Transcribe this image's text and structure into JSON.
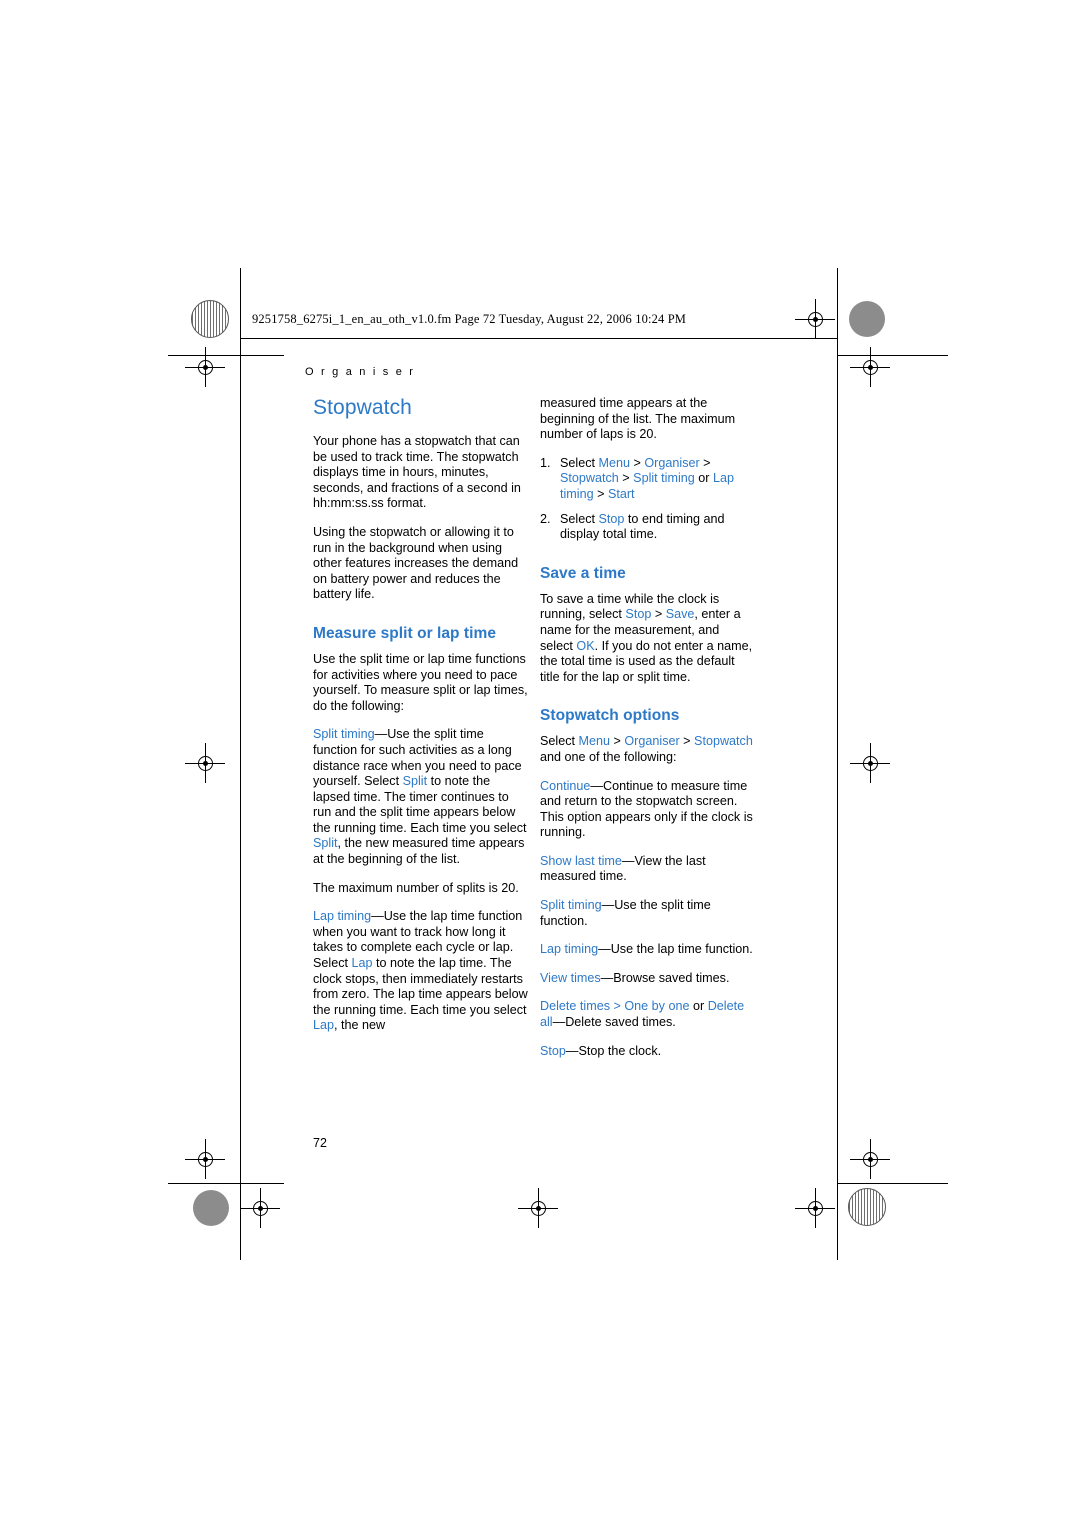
{
  "header": {
    "file_line": "9251758_6275i_1_en_au_oth_v1.0.fm  Page 72  Tuesday, August 22, 2006  10:24 PM",
    "chapter": "O r g a n i s e r",
    "page_number": "72"
  },
  "colors": {
    "accent": "#2d79c7",
    "text": "#000000",
    "paper": "#ffffff"
  },
  "left_column": {
    "title": "Stopwatch",
    "p1": "Your phone has a stopwatch that can be used to track time. The stopwatch displays time in hours, minutes, seconds, and fractions of a second in hh:mm:ss.ss format.",
    "p2": "Using the stopwatch or allowing it to run in the background when using other features increases the demand on battery power and reduces the battery life.",
    "h_measure": "Measure split or lap time",
    "p3": "Use the split time or lap time functions for activities where you need to pace yourself. To measure split or lap times, do the following:",
    "split_term": "Split timing",
    "split_dash": "—",
    "split_body_a": "Use the split time function for such activities as a long distance race when you need to pace yourself. Select ",
    "split_kw1": "Split",
    "split_body_b": " to note the lapsed time. The timer continues to run and the split time appears below the running time. Each time you select ",
    "split_kw2": "Split",
    "split_body_c": ", the new measured time appears at the beginning of the list.",
    "p_max_splits": "The maximum number of splits is 20.",
    "lap_term": "Lap timing",
    "lap_dash": "—",
    "lap_body_a": "Use the lap time function when you want to track how long it takes to complete each cycle or lap. Select ",
    "lap_kw1": "Lap",
    "lap_body_b": " to note the lap time. The clock stops, then immediately restarts from zero. The lap time appears below the running time. Each time you select ",
    "lap_kw2": "Lap",
    "lap_body_c": ", the new"
  },
  "right_column": {
    "cont_p": "measured time appears at the beginning of the list. The maximum number of laps is 20.",
    "step1_num": "1.",
    "step1_a": "Select ",
    "step1_kw_menu": "Menu",
    "step1_b": " > ",
    "step1_kw_org": "Organiser",
    "step1_c": " > ",
    "step1_kw_stopwatch": "Stopwatch",
    "step1_d": " > ",
    "step1_kw_split": "Split timing",
    "step1_e": " or ",
    "step1_kw_lap": "Lap timing",
    "step1_f": " > ",
    "step1_kw_start": "Start",
    "step2_num": "2.",
    "step2_a": "Select ",
    "step2_kw_stop": "Stop",
    "step2_b": " to end timing and display total time.",
    "h_save": "Save a time",
    "save_a": "To save a time while the clock is running, select ",
    "save_kw_stop": "Stop",
    "save_b": " > ",
    "save_kw_save": "Save",
    "save_c": ", enter a name for the measurement, and select ",
    "save_kw_ok": "OK",
    "save_d": ". If you do not enter a name, the total time is used as the default title for the lap or split time.",
    "h_options": "Stopwatch options",
    "opt_intro_a": "Select ",
    "opt_kw_menu": "Menu",
    "opt_intro_b": " > ",
    "opt_kw_org": "Organiser",
    "opt_intro_c": " > ",
    "opt_kw_stopwatch": "Stopwatch",
    "opt_intro_d": " and one of the following:",
    "continue_term": "Continue",
    "continue_dash": "—",
    "continue_body": "Continue to measure time and return to the stopwatch screen. This option appears only if the clock is running.",
    "showlast_term": "Show last time",
    "showlast_dash": "—",
    "showlast_body": "View the last measured time.",
    "splittiming_term": "Split timing",
    "splittiming_dash": "—",
    "splittiming_body": "Use the split time function.",
    "laptiming_term": "Lap timing",
    "laptiming_dash": "—",
    "laptiming_body": "Use the lap time function.",
    "viewtimes_term": "View times",
    "viewtimes_dash": "—",
    "viewtimes_body": "Browse saved times.",
    "delete_term1": "Delete times",
    "delete_sep1": " > ",
    "delete_term2": "One by one",
    "delete_or": " or ",
    "delete_term3": "Delete all",
    "delete_dash": "—",
    "delete_body": "Delete saved times.",
    "stop_term": "Stop",
    "stop_dash": "—",
    "stop_body": "Stop the clock."
  }
}
